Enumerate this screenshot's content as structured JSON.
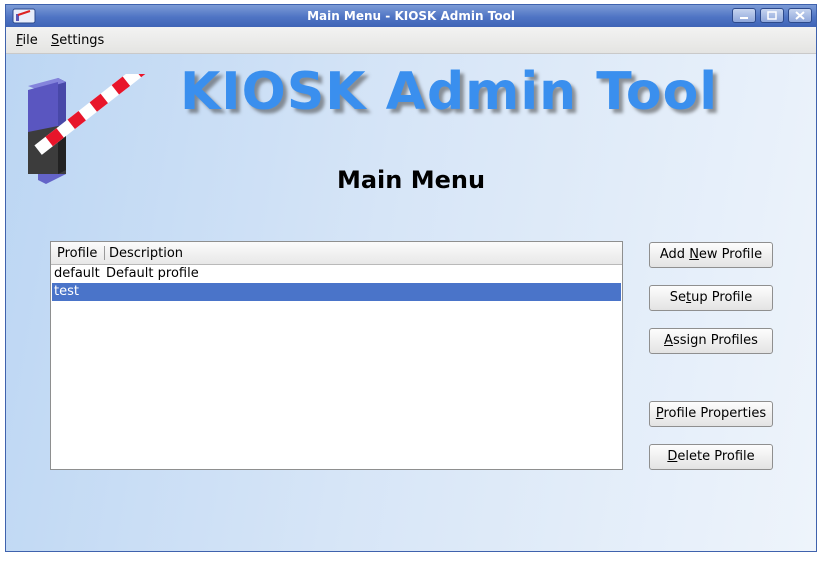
{
  "window": {
    "title": "Main Menu - KIOSK Admin Tool",
    "controls": [
      "minimize",
      "maximize",
      "close"
    ]
  },
  "menubar": {
    "file": {
      "mnemonic": "F",
      "rest": "ile"
    },
    "settings": {
      "mnemonic": "S",
      "rest": "ettings"
    }
  },
  "header": {
    "app_title": "KIOSK Admin Tool",
    "page_title": "Main Menu",
    "logo_icon": "barrier-gate-icon"
  },
  "profiles_table": {
    "columns": [
      "Profile",
      "Description"
    ],
    "rows": [
      {
        "profile": "default",
        "description": "Default profile",
        "selected": false
      },
      {
        "profile": "test",
        "description": "",
        "selected": true
      }
    ]
  },
  "buttons": {
    "add_new_profile": {
      "pre": "Add ",
      "mnemonic": "N",
      "post": "ew Profile"
    },
    "setup_profile": {
      "pre": "Se",
      "mnemonic": "t",
      "post": "up Profile"
    },
    "assign_profiles": {
      "pre": "",
      "mnemonic": "A",
      "post": "ssign Profiles"
    },
    "profile_properties": {
      "pre": "",
      "mnemonic": "P",
      "post": "rofile Properties"
    },
    "delete_profile": {
      "pre": "",
      "mnemonic": "D",
      "post": "elete Profile"
    }
  },
  "colors": {
    "title_accent": "#3a8fee",
    "selection": "#4a74c9",
    "titlebar": "#4f74c4"
  }
}
